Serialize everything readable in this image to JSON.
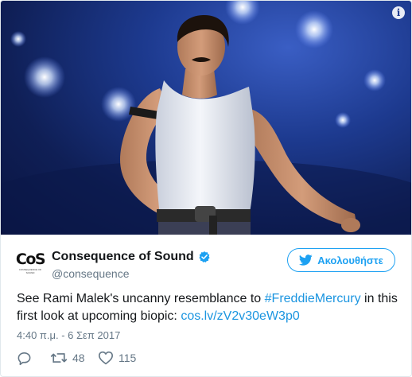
{
  "media": {
    "icon": "info-icon",
    "info_glyph": "i"
  },
  "author": {
    "logo_text": "CoS",
    "logo_subtext": "CONSEQUENCE OF SOUND",
    "name": "Consequence of Sound",
    "handle": "@consequence",
    "verified": true
  },
  "follow_button": {
    "label": "Ακολουθήστε",
    "icon": "twitter-bird-icon"
  },
  "tweet": {
    "text_before": "See Rami Malek's uncanny resemblance to ",
    "hashtag": "#FreddieMercury",
    "text_after": " in this first look at upcoming biopic: ",
    "link": "cos.lv/zV2v30eW3p0",
    "timestamp": "4:40 π.μ. - 6 Σεπ 2017"
  },
  "actions": {
    "reply": {
      "icon": "reply-icon"
    },
    "retweet": {
      "icon": "retweet-icon",
      "count": "48"
    },
    "like": {
      "icon": "heart-icon",
      "count": "115"
    }
  },
  "colors": {
    "accent": "#1da1f2",
    "link": "#1b95e0",
    "muted": "#657786",
    "text": "#14171a"
  }
}
